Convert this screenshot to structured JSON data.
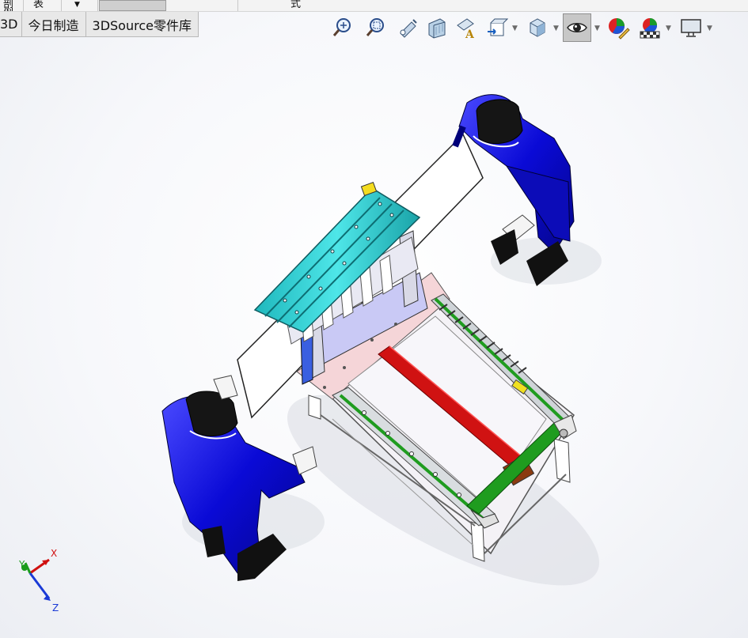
{
  "top_strip": {
    "items": [
      "剖例",
      "表",
      "▼",
      "",
      "式"
    ]
  },
  "tabs": [
    "3D",
    "今日制造",
    "3DSource零件库"
  ],
  "view_toolbar": {
    "buttons": [
      {
        "name": "zoom-to-fit-icon",
        "has_dropdown": false,
        "pressed": false
      },
      {
        "name": "zoom-to-area-icon",
        "has_dropdown": false,
        "pressed": false
      },
      {
        "name": "previous-view-icon",
        "has_dropdown": false,
        "pressed": false
      },
      {
        "name": "section-view-icon",
        "has_dropdown": false,
        "pressed": false
      },
      {
        "name": "dynamic-annotation-views-icon",
        "has_dropdown": false,
        "pressed": false
      },
      {
        "name": "view-orientation-icon",
        "has_dropdown": true,
        "pressed": false
      },
      {
        "name": "display-style-icon",
        "has_dropdown": true,
        "pressed": false
      },
      {
        "name": "hide-show-items-icon",
        "has_dropdown": true,
        "pressed": true
      },
      {
        "name": "edit-appearance-icon",
        "has_dropdown": false,
        "pressed": false
      },
      {
        "name": "apply-scene-icon",
        "has_dropdown": true,
        "pressed": false
      },
      {
        "name": "view-settings-icon",
        "has_dropdown": true,
        "pressed": false
      }
    ]
  },
  "triad": {
    "x_label": "X",
    "y_label": "Y",
    "z_label": "Z"
  },
  "colors": {
    "rail_top": "#33d6d9",
    "carriage_plate": "#c9c9f5",
    "base_plate": "#f5d5d8",
    "beam": "#cc1010",
    "frame_green": "#1f9c1f",
    "operator": "#1010d8",
    "table_frame": "#f2f0f4"
  }
}
